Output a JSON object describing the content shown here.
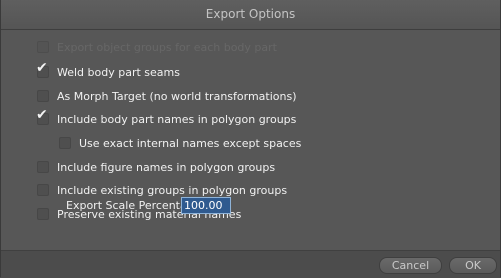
{
  "window": {
    "title": "Export Options"
  },
  "options": [
    {
      "label": "Export object groups for each body part",
      "checked": false,
      "disabled": true
    },
    {
      "label": "Weld body part seams",
      "checked": true,
      "disabled": false
    },
    {
      "label": "As Morph Target (no world transformations)",
      "checked": false,
      "disabled": false
    },
    {
      "label": "Include body part names in polygon groups",
      "checked": true,
      "disabled": false
    },
    {
      "label": "Use exact internal names except spaces",
      "checked": false,
      "disabled": false
    },
    {
      "label": "Include figure names in polygon groups",
      "checked": false,
      "disabled": false
    },
    {
      "label": "Include existing groups in polygon groups",
      "checked": false,
      "disabled": false
    },
    {
      "label": "Preserve existing material names",
      "checked": false,
      "disabled": false
    }
  ],
  "scale": {
    "label": "Export Scale Percentage:",
    "value": "100.00"
  },
  "buttons": {
    "cancel_label": "Cancel",
    "ok_label": "OK"
  },
  "icons": {
    "checkmark": "checkmark-icon"
  },
  "colors": {
    "selection": "#2f5a8f",
    "background": "#545454",
    "text": "#f1f1f1"
  }
}
